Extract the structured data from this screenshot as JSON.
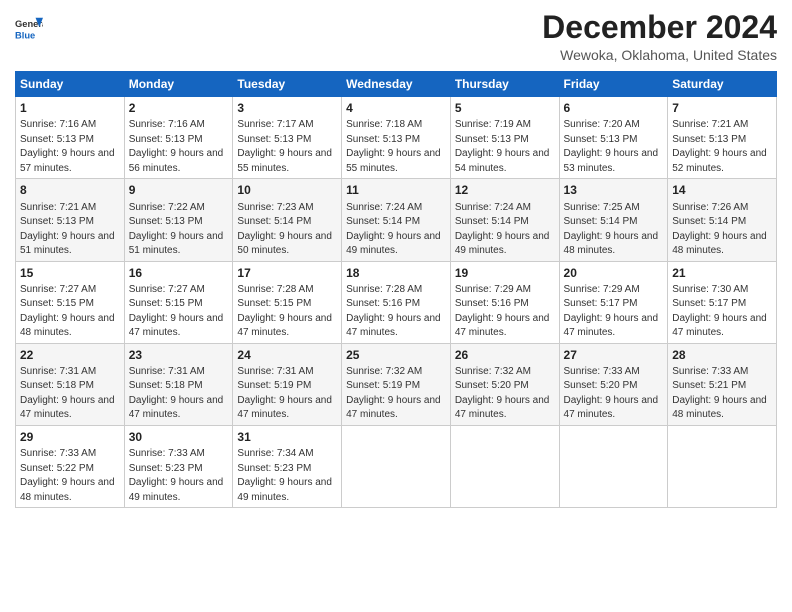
{
  "header": {
    "logo_line1": "General",
    "logo_line2": "Blue",
    "month_title": "December 2024",
    "location": "Wewoka, Oklahoma, United States"
  },
  "weekdays": [
    "Sunday",
    "Monday",
    "Tuesday",
    "Wednesday",
    "Thursday",
    "Friday",
    "Saturday"
  ],
  "weeks": [
    [
      {
        "day": "1",
        "sunrise": "7:16 AM",
        "sunset": "5:13 PM",
        "daylight": "9 hours and 57 minutes."
      },
      {
        "day": "2",
        "sunrise": "7:16 AM",
        "sunset": "5:13 PM",
        "daylight": "9 hours and 56 minutes."
      },
      {
        "day": "3",
        "sunrise": "7:17 AM",
        "sunset": "5:13 PM",
        "daylight": "9 hours and 55 minutes."
      },
      {
        "day": "4",
        "sunrise": "7:18 AM",
        "sunset": "5:13 PM",
        "daylight": "9 hours and 55 minutes."
      },
      {
        "day": "5",
        "sunrise": "7:19 AM",
        "sunset": "5:13 PM",
        "daylight": "9 hours and 54 minutes."
      },
      {
        "day": "6",
        "sunrise": "7:20 AM",
        "sunset": "5:13 PM",
        "daylight": "9 hours and 53 minutes."
      },
      {
        "day": "7",
        "sunrise": "7:21 AM",
        "sunset": "5:13 PM",
        "daylight": "9 hours and 52 minutes."
      }
    ],
    [
      {
        "day": "8",
        "sunrise": "7:21 AM",
        "sunset": "5:13 PM",
        "daylight": "9 hours and 51 minutes."
      },
      {
        "day": "9",
        "sunrise": "7:22 AM",
        "sunset": "5:13 PM",
        "daylight": "9 hours and 51 minutes."
      },
      {
        "day": "10",
        "sunrise": "7:23 AM",
        "sunset": "5:14 PM",
        "daylight": "9 hours and 50 minutes."
      },
      {
        "day": "11",
        "sunrise": "7:24 AM",
        "sunset": "5:14 PM",
        "daylight": "9 hours and 49 minutes."
      },
      {
        "day": "12",
        "sunrise": "7:24 AM",
        "sunset": "5:14 PM",
        "daylight": "9 hours and 49 minutes."
      },
      {
        "day": "13",
        "sunrise": "7:25 AM",
        "sunset": "5:14 PM",
        "daylight": "9 hours and 48 minutes."
      },
      {
        "day": "14",
        "sunrise": "7:26 AM",
        "sunset": "5:14 PM",
        "daylight": "9 hours and 48 minutes."
      }
    ],
    [
      {
        "day": "15",
        "sunrise": "7:27 AM",
        "sunset": "5:15 PM",
        "daylight": "9 hours and 48 minutes."
      },
      {
        "day": "16",
        "sunrise": "7:27 AM",
        "sunset": "5:15 PM",
        "daylight": "9 hours and 47 minutes."
      },
      {
        "day": "17",
        "sunrise": "7:28 AM",
        "sunset": "5:15 PM",
        "daylight": "9 hours and 47 minutes."
      },
      {
        "day": "18",
        "sunrise": "7:28 AM",
        "sunset": "5:16 PM",
        "daylight": "9 hours and 47 minutes."
      },
      {
        "day": "19",
        "sunrise": "7:29 AM",
        "sunset": "5:16 PM",
        "daylight": "9 hours and 47 minutes."
      },
      {
        "day": "20",
        "sunrise": "7:29 AM",
        "sunset": "5:17 PM",
        "daylight": "9 hours and 47 minutes."
      },
      {
        "day": "21",
        "sunrise": "7:30 AM",
        "sunset": "5:17 PM",
        "daylight": "9 hours and 47 minutes."
      }
    ],
    [
      {
        "day": "22",
        "sunrise": "7:31 AM",
        "sunset": "5:18 PM",
        "daylight": "9 hours and 47 minutes."
      },
      {
        "day": "23",
        "sunrise": "7:31 AM",
        "sunset": "5:18 PM",
        "daylight": "9 hours and 47 minutes."
      },
      {
        "day": "24",
        "sunrise": "7:31 AM",
        "sunset": "5:19 PM",
        "daylight": "9 hours and 47 minutes."
      },
      {
        "day": "25",
        "sunrise": "7:32 AM",
        "sunset": "5:19 PM",
        "daylight": "9 hours and 47 minutes."
      },
      {
        "day": "26",
        "sunrise": "7:32 AM",
        "sunset": "5:20 PM",
        "daylight": "9 hours and 47 minutes."
      },
      {
        "day": "27",
        "sunrise": "7:33 AM",
        "sunset": "5:20 PM",
        "daylight": "9 hours and 47 minutes."
      },
      {
        "day": "28",
        "sunrise": "7:33 AM",
        "sunset": "5:21 PM",
        "daylight": "9 hours and 48 minutes."
      }
    ],
    [
      {
        "day": "29",
        "sunrise": "7:33 AM",
        "sunset": "5:22 PM",
        "daylight": "9 hours and 48 minutes."
      },
      {
        "day": "30",
        "sunrise": "7:33 AM",
        "sunset": "5:23 PM",
        "daylight": "9 hours and 49 minutes."
      },
      {
        "day": "31",
        "sunrise": "7:34 AM",
        "sunset": "5:23 PM",
        "daylight": "9 hours and 49 minutes."
      },
      null,
      null,
      null,
      null
    ]
  ]
}
